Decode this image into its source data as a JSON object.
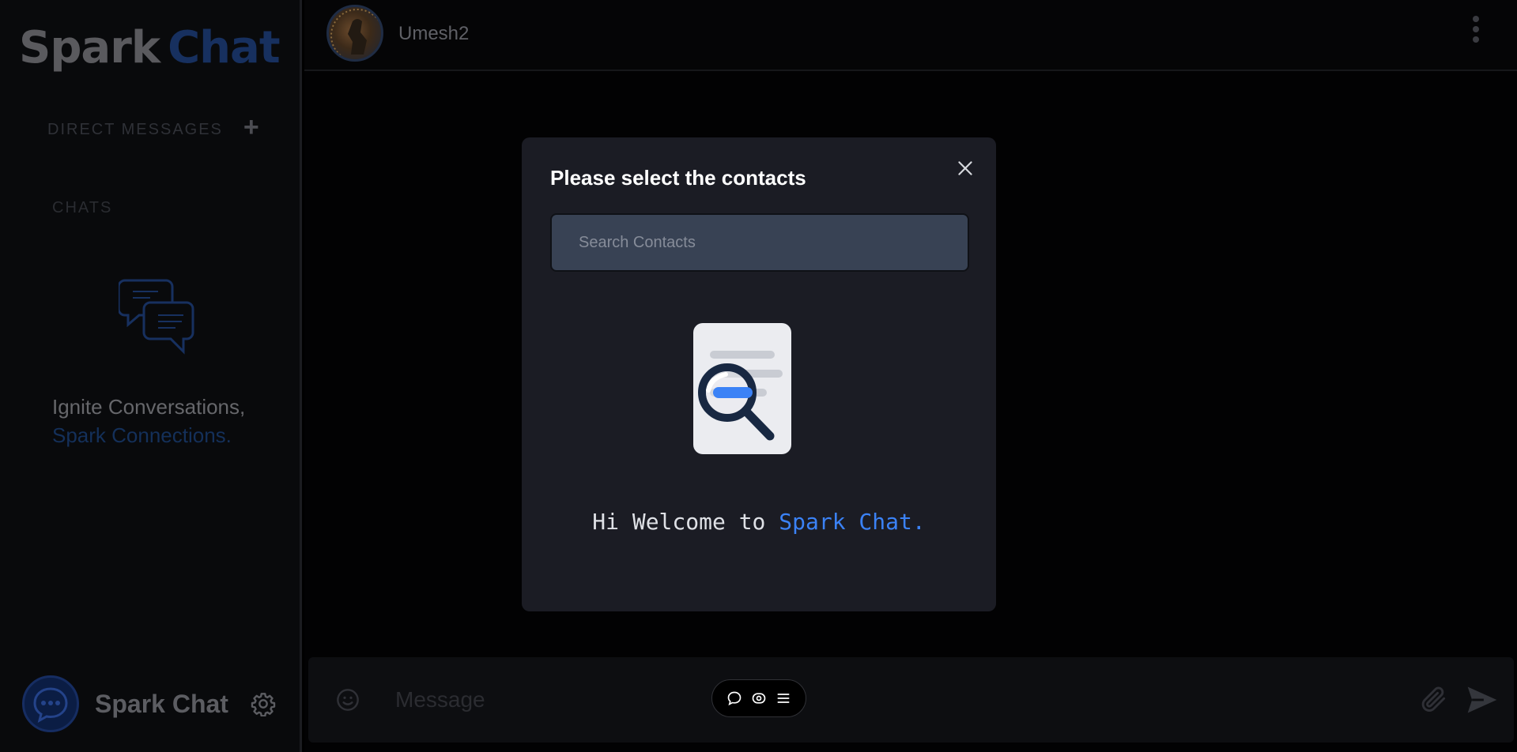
{
  "app": {
    "logo_word1": "Spark",
    "logo_word2": "Chat"
  },
  "sidebar": {
    "direct_messages_label": "DIRECT MESSAGES",
    "add_label": "+",
    "chats_label": "CHATS",
    "tagline_line1": "Ignite Conversations,",
    "tagline_line2": "Spark Connections.",
    "profile_name": "Spark Chat"
  },
  "header": {
    "contact_name": "Umesh2"
  },
  "composer": {
    "placeholder": "Message"
  },
  "modal": {
    "title": "Please select the contacts",
    "search_placeholder": "Search Contacts",
    "welcome_prefix": "Hi Welcome to ",
    "welcome_accent": "Spark Chat."
  },
  "colors": {
    "accent": "#3b82f6",
    "brand_dim": "#17305f",
    "modal_bg": "#1b1c24",
    "search_bg": "#384254"
  },
  "icons": {
    "add": "plus-icon",
    "chat_illustration": "chat-bubbles-icon",
    "settings": "gear-icon",
    "menu": "kebab-menu-icon",
    "emoji": "emoji-icon",
    "attach": "paperclip-icon",
    "send": "send-icon",
    "close": "close-icon",
    "empty_state": "document-search-icon",
    "toolbar": [
      "comment-icon",
      "eye-icon",
      "list-icon"
    ]
  }
}
